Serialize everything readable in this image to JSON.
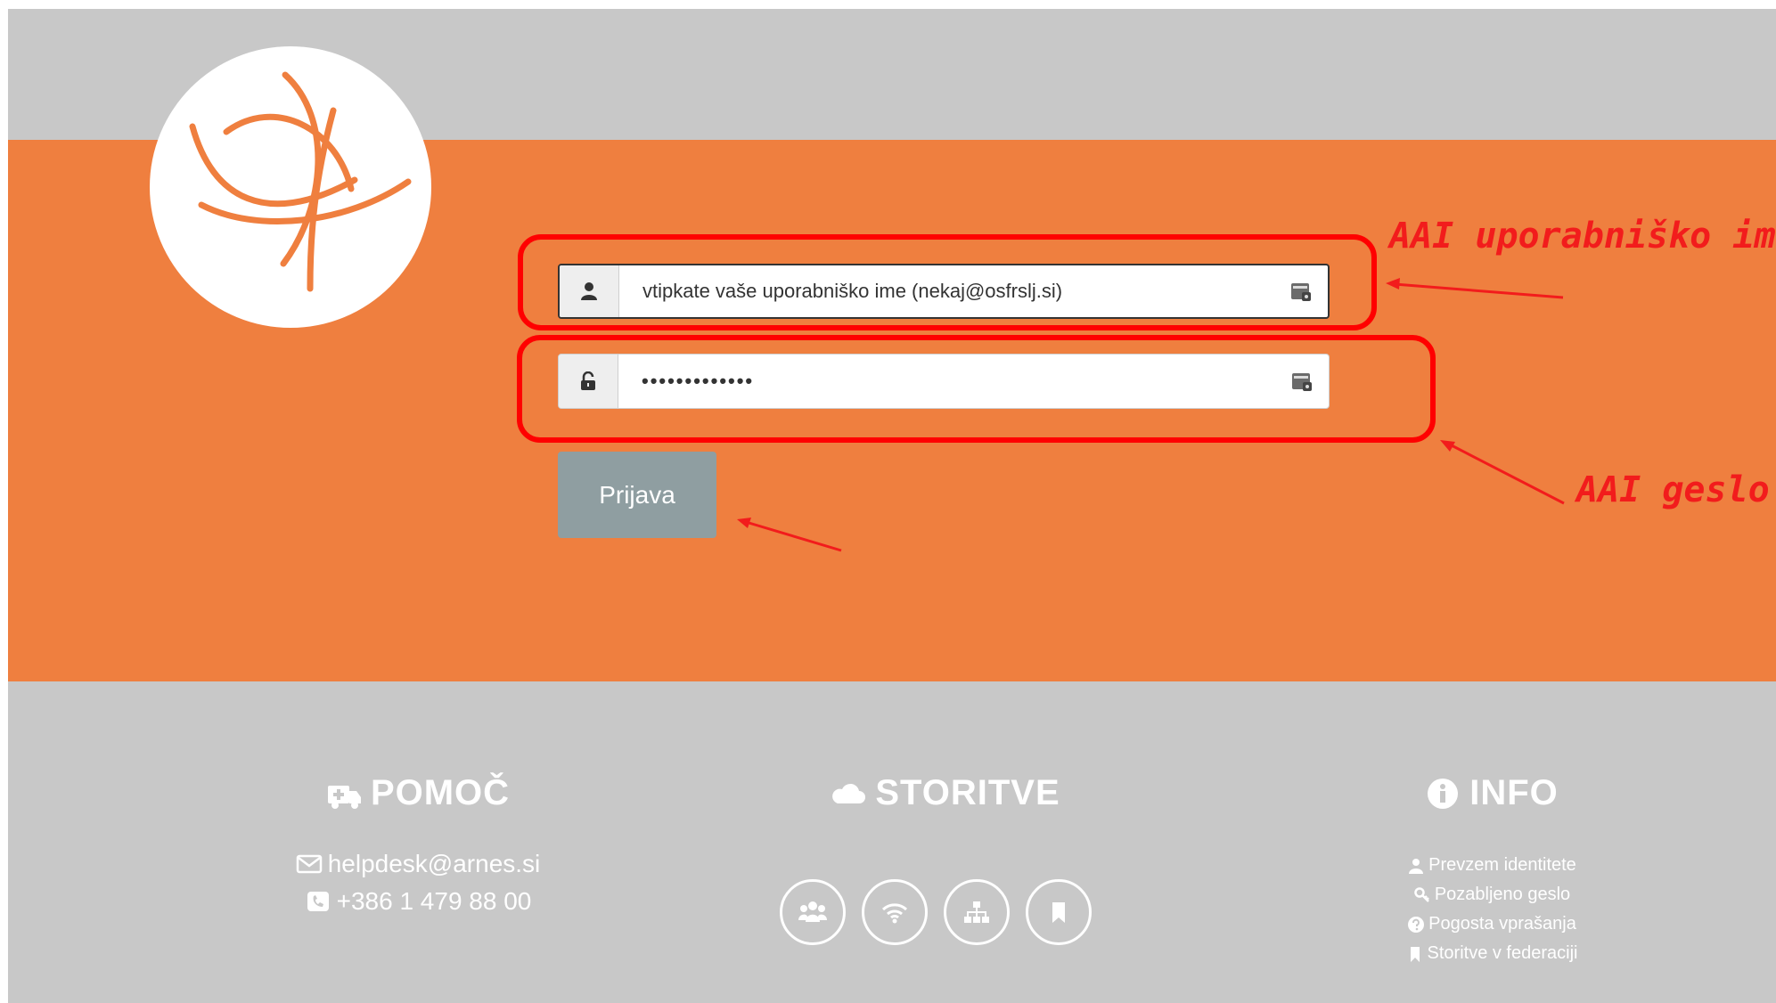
{
  "login": {
    "username_value": "vtipkate vaše uporabniško ime (nekaj@osfrslj.si)",
    "password_mask": "•••••••••••••",
    "submit_label": "Prijava"
  },
  "annotations": {
    "username": "AAI uporabniško ime",
    "password": "AAI geslo"
  },
  "footer": {
    "help": {
      "title": "POMOČ",
      "email": "helpdesk@arnes.si",
      "phone": "+386 1 479 88 00"
    },
    "services": {
      "title": "STORITVE",
      "icons": [
        "users-icon",
        "wifi-icon",
        "sitemap-icon",
        "bookmark-icon"
      ]
    },
    "info": {
      "title": "INFO",
      "links": [
        {
          "label": "Prevzem identitete",
          "icon": "user-icon"
        },
        {
          "label": "Pozabljeno geslo",
          "icon": "key-icon"
        },
        {
          "label": "Pogosta vprašanja",
          "icon": "question-circle-icon"
        },
        {
          "label": "Storitve v federaciji",
          "icon": "bookmark-icon"
        }
      ]
    }
  },
  "colors": {
    "brand_orange": "#ef7f3f",
    "page_gray": "#c8c8c8",
    "button_gray": "#8f9ea1",
    "annotation_red": "#f21c1c"
  }
}
